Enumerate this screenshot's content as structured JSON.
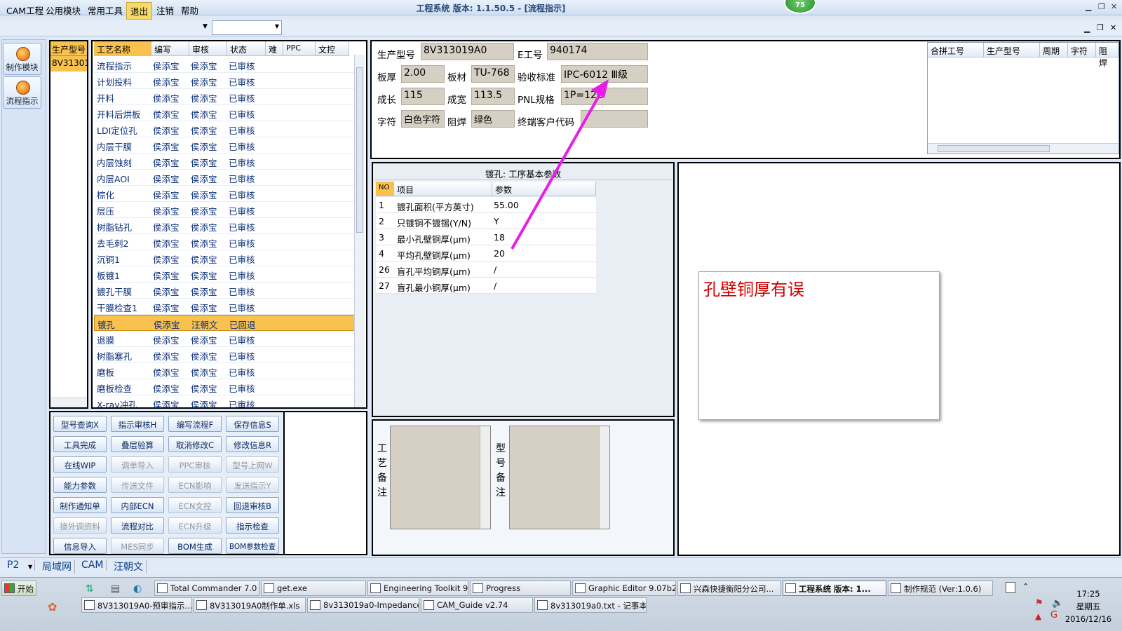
{
  "window": {
    "title": "工程系统  版本: 1.1.50.5 - [流程指示]",
    "badge": "75"
  },
  "menu": {
    "items": [
      "CAM工程",
      "公用模块",
      "常用工具",
      "退出",
      "注销",
      "帮助"
    ]
  },
  "left_nav": [
    {
      "label": "制作模块"
    },
    {
      "label": "流程指示"
    }
  ],
  "code_panel": {
    "header": "生产型号",
    "value": "8V31301"
  },
  "process_grid": {
    "columns": [
      "工艺名称",
      "编写",
      "审核",
      "状态",
      "难",
      "PPC",
      "文控"
    ],
    "rows": [
      [
        "流程指示",
        "侯添宝",
        "侯添宝",
        "已审核"
      ],
      [
        "计划投料",
        "侯添宝",
        "侯添宝",
        "已审核"
      ],
      [
        "开料",
        "侯添宝",
        "侯添宝",
        "已审核"
      ],
      [
        "开料后烘板",
        "侯添宝",
        "侯添宝",
        "已审核"
      ],
      [
        "LDI定位孔",
        "侯添宝",
        "侯添宝",
        "已审核"
      ],
      [
        "内层干膜",
        "侯添宝",
        "侯添宝",
        "已审核"
      ],
      [
        "内层蚀刻",
        "侯添宝",
        "侯添宝",
        "已审核"
      ],
      [
        "内层AOI",
        "侯添宝",
        "侯添宝",
        "已审核"
      ],
      [
        "棕化",
        "侯添宝",
        "侯添宝",
        "已审核"
      ],
      [
        "层压",
        "侯添宝",
        "侯添宝",
        "已审核"
      ],
      [
        "树脂钻孔",
        "侯添宝",
        "侯添宝",
        "已审核"
      ],
      [
        "去毛刺2",
        "侯添宝",
        "侯添宝",
        "已审核"
      ],
      [
        "沉铜1",
        "侯添宝",
        "侯添宝",
        "已审核"
      ],
      [
        "板镀1",
        "侯添宝",
        "侯添宝",
        "已审核"
      ],
      [
        "镀孔干膜",
        "侯添宝",
        "侯添宝",
        "已审核"
      ],
      [
        "干膜检查1",
        "侯添宝",
        "侯添宝",
        "已审核"
      ],
      [
        "镀孔",
        "侯添宝",
        "汪朝文",
        "已回退"
      ],
      [
        "退膜",
        "侯添宝",
        "侯添宝",
        "已审核"
      ],
      [
        "树脂塞孔",
        "侯添宝",
        "侯添宝",
        "已审核"
      ],
      [
        "磨板",
        "侯添宝",
        "侯添宝",
        "已审核"
      ],
      [
        "磨板检查",
        "侯添宝",
        "侯添宝",
        "已审核"
      ],
      [
        "X-ray冲孔",
        "侯添宝",
        "侯添宝",
        "已审核"
      ]
    ]
  },
  "function_buttons": [
    [
      "型号查询X",
      "指示审核H",
      "编写流程F",
      "保存信息S"
    ],
    [
      "工具完成",
      "叠层验算",
      "取消修改C",
      "修改信息R"
    ],
    [
      "在线WIP",
      "调单导入",
      "PPC审核",
      "型号上网W"
    ],
    [
      "能力参数",
      "传送文件",
      "ECN影响",
      "发送指示Y"
    ],
    [
      "制作通知单",
      "内部ECN",
      "ECN文控",
      "回退审核B"
    ],
    [
      "接外调资料",
      "流程对比",
      "ECN升级",
      "指示检查"
    ],
    [
      "信息导入",
      "MES同步",
      "BOM生成",
      "BOM参数检查"
    ]
  ],
  "info": {
    "prod_no_label": "生产型号",
    "prod_no": "8V313019A0",
    "e_no_label": "E工号",
    "e_no": "940174",
    "thickness_label": "板厚",
    "thickness": "2.00",
    "material_label": "板材",
    "material": "TU-768",
    "standard_label": "验收标准",
    "standard": "IPC-6012 Ⅲ级",
    "length_label": "成长",
    "length": "115",
    "width_label": "成宽",
    "width": "113.5",
    "pnl_label": "PNL规格",
    "pnl": "1P=12U",
    "char_label": "字符",
    "char": "白色字符",
    "mask_label": "阻焊",
    "mask": "绿色",
    "customer_label": "终端客户代码",
    "customer": ""
  },
  "merge_grid": {
    "columns": [
      "合拼工号",
      "生产型号",
      "周期",
      "字符",
      "阻焊"
    ]
  },
  "param_panel": {
    "title": "镀孔: 工序基本参数",
    "columns": [
      "NO",
      "项目",
      "参数"
    ],
    "rows": [
      [
        "1",
        "镀孔面积(平方英寸)",
        "55.00"
      ],
      [
        "2",
        "只镀铜不镀锡(Y/N)",
        "Y"
      ],
      [
        "3",
        "最小孔壁铜厚(μm)",
        "18"
      ],
      [
        "4",
        "平均孔壁铜厚(μm)",
        "20"
      ],
      [
        "26",
        "盲孔平均铜厚(μm)",
        "/"
      ],
      [
        "27",
        "盲孔最小铜厚(μm)",
        "/"
      ]
    ]
  },
  "notes": {
    "process_label": "工艺备注",
    "model_label": "型号备注"
  },
  "annotation": {
    "text": "孔壁铜厚有误",
    "arrow_color": "#e81ee8"
  },
  "status": {
    "items": [
      "P2",
      "局域网",
      "CAM",
      "汪朝文"
    ]
  },
  "taskbar": {
    "start": "开始",
    "row1": [
      "Total Commander 7.0 ...",
      "get.exe",
      "Engineering Toolkit 9....",
      "Progress",
      "Graphic Editor 9.07b2 ...",
      "兴森快捷衡阳分公司...",
      "工程系统  版本: 1...",
      "制作规范 (Ver:1.0.6)"
    ],
    "row2": [
      "8V313019A0-预审指示....",
      "8V313019A0制作单.xls",
      "8v313019a0-Impedance ...",
      "CAM_Guide v2.74",
      "8v313019a0.txt - 记事本"
    ],
    "time": "17:25",
    "weekday": "星期五",
    "date": "2016/12/16"
  }
}
